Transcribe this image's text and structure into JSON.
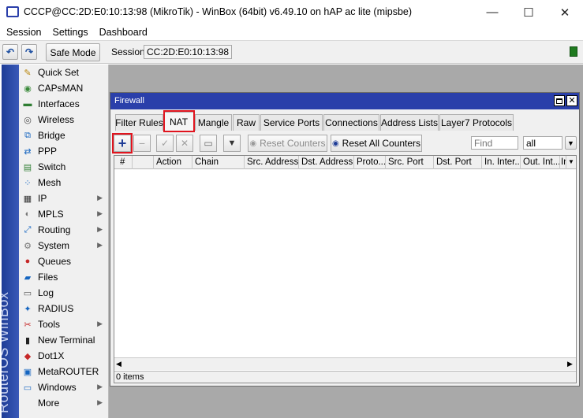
{
  "window": {
    "title": "CCCP@CC:2D:E0:10:13:98 (MikroTik) - WinBox (64bit) v6.49.10 on hAP ac lite (mipsbe)",
    "minimize": "—",
    "maximize": "☐",
    "close": "✕"
  },
  "menubar": {
    "items": [
      "Session",
      "Settings",
      "Dashboard"
    ]
  },
  "toolbar": {
    "undo": "↶",
    "redo": "↷",
    "safe_mode": "Safe Mode",
    "session_label": "Session:",
    "session_value": "CC:2D:E0:10:13:98"
  },
  "sidebar": {
    "brand": "RouterOS WinBox",
    "items": [
      {
        "label": "Quick Set",
        "icon": "quick-set-icon",
        "glyph": "✎",
        "color": "#b8860b",
        "submenu": false
      },
      {
        "label": "CAPsMAN",
        "icon": "capsman-icon",
        "glyph": "◉",
        "color": "#3a8a3a",
        "submenu": false
      },
      {
        "label": "Interfaces",
        "icon": "interfaces-icon",
        "glyph": "▬",
        "color": "#2e7d32",
        "submenu": false
      },
      {
        "label": "Wireless",
        "icon": "wireless-icon",
        "glyph": "◎",
        "color": "#4a4a4a",
        "submenu": false
      },
      {
        "label": "Bridge",
        "icon": "bridge-icon",
        "glyph": "⧉",
        "color": "#1565c0",
        "submenu": false
      },
      {
        "label": "PPP",
        "icon": "ppp-icon",
        "glyph": "⇄",
        "color": "#1565c0",
        "submenu": false
      },
      {
        "label": "Switch",
        "icon": "switch-icon",
        "glyph": "▤",
        "color": "#2e7d32",
        "submenu": false
      },
      {
        "label": "Mesh",
        "icon": "mesh-icon",
        "glyph": "⁘",
        "color": "#1565c0",
        "submenu": false
      },
      {
        "label": "IP",
        "icon": "ip-icon",
        "glyph": "▦",
        "color": "#333333",
        "submenu": true
      },
      {
        "label": "MPLS",
        "icon": "mpls-icon",
        "glyph": "◐",
        "color": "#777777",
        "submenu": true
      },
      {
        "label": "Routing",
        "icon": "routing-icon",
        "glyph": "⤢",
        "color": "#1565c0",
        "submenu": true
      },
      {
        "label": "System",
        "icon": "system-icon",
        "glyph": "⚙",
        "color": "#777777",
        "submenu": true
      },
      {
        "label": "Queues",
        "icon": "queues-icon",
        "glyph": "●",
        "color": "#c62828",
        "submenu": false
      },
      {
        "label": "Files",
        "icon": "files-icon",
        "glyph": "▰",
        "color": "#1565c0",
        "submenu": false
      },
      {
        "label": "Log",
        "icon": "log-icon",
        "glyph": "▭",
        "color": "#555555",
        "submenu": false
      },
      {
        "label": "RADIUS",
        "icon": "radius-icon",
        "glyph": "✦",
        "color": "#1565c0",
        "submenu": false
      },
      {
        "label": "Tools",
        "icon": "tools-icon",
        "glyph": "✂",
        "color": "#c62828",
        "submenu": true
      },
      {
        "label": "New Terminal",
        "icon": "terminal-icon",
        "glyph": "▮",
        "color": "#222222",
        "submenu": false
      },
      {
        "label": "Dot1X",
        "icon": "dot1x-icon",
        "glyph": "◆",
        "color": "#c62828",
        "submenu": false
      },
      {
        "label": "MetaROUTER",
        "icon": "metarouter-icon",
        "glyph": "▣",
        "color": "#1565c0",
        "submenu": false
      },
      {
        "label": "Windows",
        "icon": "windows-icon",
        "glyph": "▭",
        "color": "#1565c0",
        "submenu": true
      },
      {
        "label": "More",
        "icon": "",
        "glyph": "",
        "color": "#000000",
        "submenu": true
      }
    ]
  },
  "firewall": {
    "title": "Firewall",
    "tabs": [
      "Filter Rules",
      "NAT",
      "Mangle",
      "Raw",
      "Service Ports",
      "Connections",
      "Address Lists",
      "Layer7 Protocols"
    ],
    "active_tab": "NAT",
    "buttons": {
      "add": "+",
      "remove": "−",
      "enable": "✓",
      "disable": "✕",
      "comment": "▭",
      "filter": "▼",
      "reset_counters": "Reset Counters",
      "reset_all_counters": "Reset All Counters"
    },
    "find_placeholder": "Find",
    "filter_value": "all",
    "columns": [
      "#",
      "",
      "Action",
      "Chain",
      "Src. Address",
      "Dst. Address",
      "Proto...",
      "Src. Port",
      "Dst. Port",
      "In. Inter...",
      "Out. Int...",
      "In"
    ],
    "status": "0 items"
  },
  "colors": {
    "titlebar_blue": "#2a3faa",
    "highlight_red": "#e0141e",
    "sidebar_blue": "#2845a8",
    "workspace_gray": "#a9a9a9"
  }
}
